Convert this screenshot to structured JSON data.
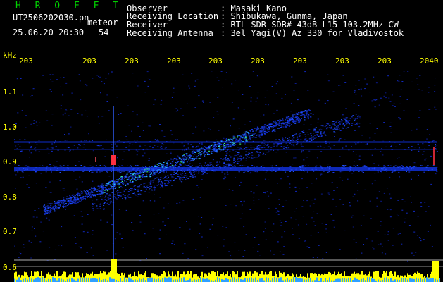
{
  "header": {
    "app_title": "H R O F F T",
    "filename": "UT2506202030.pn",
    "mode_label": "meteor",
    "datetime": "25.06.20 20:30",
    "count": "54",
    "fields": [
      {
        "label": "Observer",
        "value": ": Masaki Kano"
      },
      {
        "label": "Receiving Location",
        "value": ": Shibukawa, Gunma, Japan"
      },
      {
        "label": "Receiver",
        "value": ": RTL-SDR SDR# 43dB L15 103.2MHz CW"
      },
      {
        "label": "Receiving Antenna",
        "value": ": 3el Yagi(V) Az 330 for Vladivostok"
      }
    ]
  },
  "axis": {
    "unit": "kHz",
    "y_ticks": [
      "1.1",
      "1.0",
      "0.9",
      "0.8",
      "0.7",
      "0.6"
    ],
    "x_ticks": [
      "203",
      "203",
      "203",
      "203",
      "203",
      "203",
      "203",
      "203",
      "203",
      "2040"
    ]
  },
  "colors": {
    "title": "#00d000",
    "text": "#ffffff",
    "ticks": "#ffff00",
    "signal_low": "#1030ff",
    "signal_high": "#ff3040",
    "power_bar": "#ffff00"
  }
}
